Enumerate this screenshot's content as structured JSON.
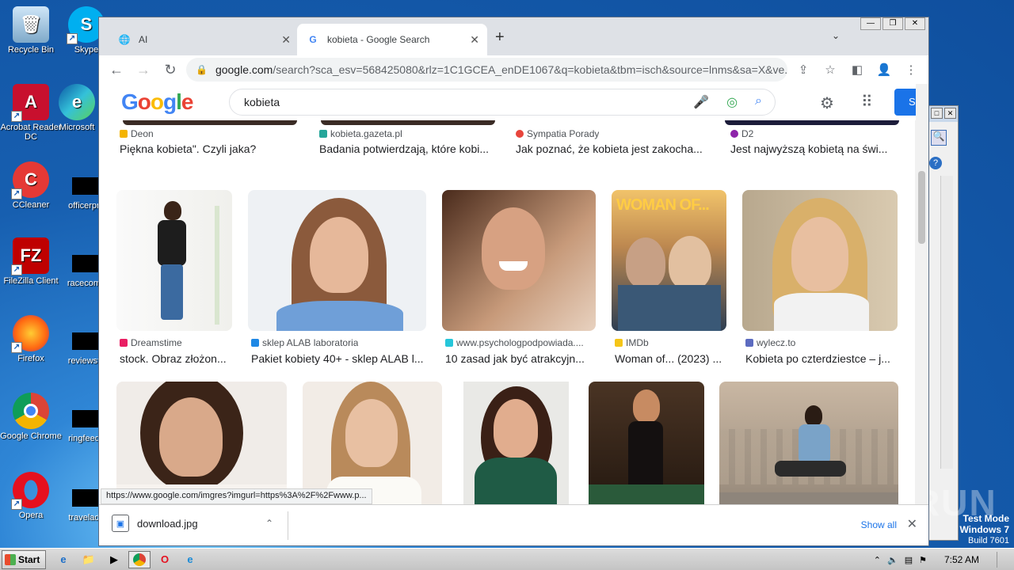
{
  "desktop": {
    "icons": [
      {
        "label": "Recycle Bin",
        "icon": "recycle-bin-icon"
      },
      {
        "label": "Skype",
        "icon": "skype-icon"
      },
      {
        "label": "Acrobat Reader DC",
        "icon": "acrobat-icon"
      },
      {
        "label": "Microsoft",
        "icon": "edge-icon"
      },
      {
        "label": "CCleaner",
        "icon": "ccleaner-icon"
      },
      {
        "label": "officerpro",
        "icon": "file-icon"
      },
      {
        "label": "FileZilla Client",
        "icon": "filezilla-icon"
      },
      {
        "label": "racecomp",
        "icon": "file-icon"
      },
      {
        "label": "Firefox",
        "icon": "firefox-icon"
      },
      {
        "label": "reviewsfu",
        "icon": "file-icon"
      },
      {
        "label": "Google Chrome",
        "icon": "chrome-icon"
      },
      {
        "label": "ringfeedb",
        "icon": "file-icon"
      },
      {
        "label": "Opera",
        "icon": "opera-icon"
      },
      {
        "label": "traveladd",
        "icon": "file-icon"
      }
    ],
    "watermark": "ANY RUN",
    "testmode": {
      "line1": "Test Mode",
      "line2": "Windows 7",
      "line3": "Build 7601"
    }
  },
  "browser": {
    "tabs": [
      {
        "title": "AI",
        "icon": "globe-icon",
        "active": false
      },
      {
        "title": "kobieta - Google Search",
        "icon": "google-g-icon",
        "active": true
      }
    ],
    "url_host": "google.com",
    "url_rest": "/search?sca_esv=568425080&rlz=1C1GCEA_enDE1067&q=kobieta&tbm=isch&source=lnms&sa=X&ve...",
    "search_query": "kobieta",
    "logo": "Google",
    "signin_label": "S",
    "status_url": "https://www.google.com/imgres?imgurl=https%3A%2F%2Fwww.p...",
    "download": {
      "filename": "download.jpg",
      "show_all": "Show all"
    }
  },
  "results_row0": [
    {
      "source": "Deon",
      "title": "Piękna kobieta\". Czyli jaka?",
      "color": "#f4b400"
    },
    {
      "source": "kobieta.gazeta.pl",
      "title": "Badania potwierdzają, które kobi...",
      "color": "#26a69a"
    },
    {
      "source": "Sympatia Porady",
      "title": "Jak poznać, że kobieta jest zakocha...",
      "color": "#e8453c"
    },
    {
      "source": "D2",
      "title": "Jest najwyższą kobietą na świ...",
      "color": "#8e24aa"
    }
  ],
  "results_row1": [
    {
      "source": "Dreamstime",
      "title": "stock. Obraz złożon...",
      "color": "#e91e63"
    },
    {
      "source": "sklep ALAB laboratoria",
      "title": "Pakiet kobiety 40+ - sklep ALAB l...",
      "color": "#1e88e5"
    },
    {
      "source": "www.psychologpodpowiada....",
      "title": "10 zasad jak być atrakcyjn...",
      "color": "#26c6da"
    },
    {
      "source": "IMDb",
      "title": "Woman of... (2023) ...",
      "color": "#f5c518"
    },
    {
      "source": "wylecz.to",
      "title": "Kobieta po czterdziestce – j...",
      "color": "#5c6bc0"
    }
  ],
  "poster_text": "WOMAN OF...",
  "taskbar": {
    "start": "Start",
    "clock": "7:52 AM"
  }
}
